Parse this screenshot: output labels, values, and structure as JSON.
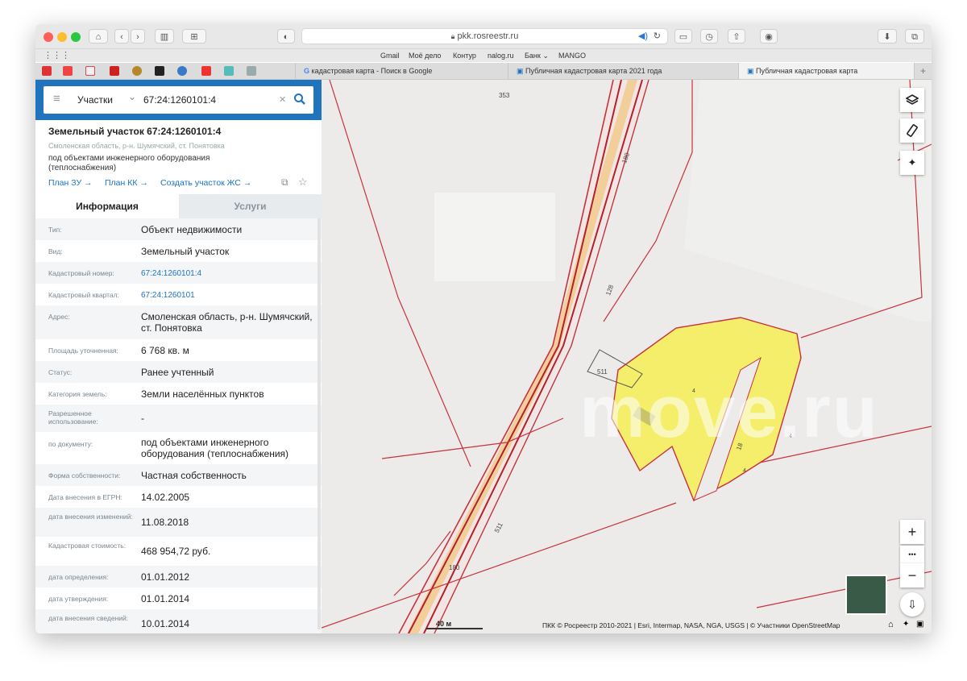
{
  "browser": {
    "url": "pkk.rosreestr.ru",
    "favorites": [
      "Gmail",
      "Моё дело",
      "Контур",
      "nalog.ru",
      "Банк ⌄",
      "MANGO"
    ],
    "tabs": [
      "кадастровая карта - Поиск в Google",
      "Публичная кадастровая карта 2021 года",
      "Публичная кадастровая карта"
    ],
    "tab_plus": "+"
  },
  "search": {
    "menu_icon": "≡",
    "type_label": "Участки",
    "chevron": "⌄",
    "query": "67:24:1260101:4",
    "clear": "✕",
    "collapse": "‹"
  },
  "parcel": {
    "title": "Земельный участок 67:24:1260101:4",
    "address": "Смоленская область, р-н. Шумячский, ст. Понятовка",
    "description": "под объектами инженерного оборудования (теплоснабжения)",
    "links": [
      "План ЗУ →",
      "План КК →",
      "Создать участок ЖС →"
    ]
  },
  "info_tabs": {
    "info": "Информация",
    "services": "Услуги"
  },
  "rows": [
    {
      "label": "Тип:",
      "value": "Объект недвижимости"
    },
    {
      "label": "Вид:",
      "value": "Земельный участок"
    },
    {
      "label": "Кадастровый номер:",
      "value": "67:24:1260101:4",
      "link": true
    },
    {
      "label": "Кадастровый квартал:",
      "value": "67:24:1260101",
      "link": true
    },
    {
      "label": "Адрес:",
      "value": "Смоленская область, р-н. Шумячский, ст. Понятовка"
    },
    {
      "label": "Площадь уточненная:",
      "value": "6 768 кв. м"
    },
    {
      "label": "Статус:",
      "value": "Ранее учтенный"
    },
    {
      "label": "Категория земель:",
      "value": "Земли населённых пунктов"
    },
    {
      "label": "Разрешенное использование:",
      "value": "-"
    },
    {
      "label": "по документу:",
      "value": "под объектами инженерного оборудования (теплоснабжения)"
    },
    {
      "label": "Форма собственности:",
      "value": "Частная собственность"
    },
    {
      "label": "Дата внесения в ЕГРН:",
      "value": "14.02.2005"
    },
    {
      "label": "дата внесения изменений:",
      "value": "11.08.2018"
    },
    {
      "label": "Кадастровая стоимость:",
      "value": "468 954,72 руб."
    },
    {
      "label": "дата определения:",
      "value": "01.01.2012"
    },
    {
      "label": "дата утверждения:",
      "value": "01.01.2014"
    },
    {
      "label": "дата внесения сведений:",
      "value": "10.01.2014"
    }
  ],
  "map": {
    "labels": [
      "353",
      "180",
      "128",
      "511",
      "18",
      "4",
      "4",
      "4",
      "180",
      "511"
    ],
    "scale": "40 м",
    "attribution": "ПКК © Росреестр 2010-2021 | Esri, Intermap, NASA, NGA, USGS | © Участники OpenStreetMap",
    "zoom_in": "+",
    "zoom_out": "−",
    "more": "•••",
    "watermark": "move.ru"
  },
  "colors": {
    "accent": "#1f74bd",
    "parcel_fill": "#f4ee6a",
    "boundary": "#c8323c"
  }
}
